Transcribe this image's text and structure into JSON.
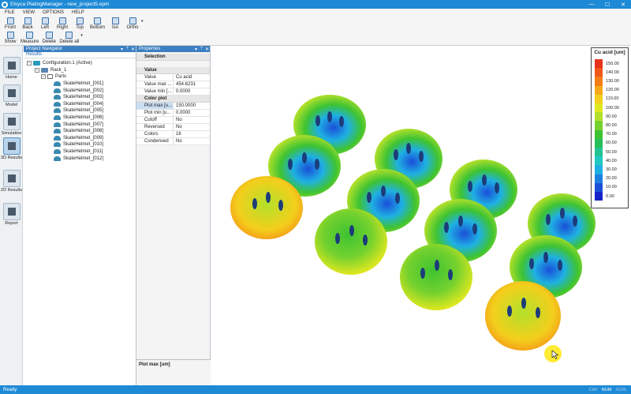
{
  "window": {
    "title": "Elsyca PlatingManager - new_project5.epm",
    "minimize": "—",
    "maximize": "☐",
    "close": "✕"
  },
  "menu": [
    "FILE",
    "VIEW",
    "OPTIONS",
    "HELP"
  ],
  "toolbar": {
    "views": [
      "Front",
      "Back",
      "Left",
      "Right",
      "Top",
      "Bottom",
      "Iso",
      "Ortho"
    ],
    "tools": [
      "Show",
      "Measure",
      "Delete",
      "Delete all"
    ]
  },
  "sidebar": {
    "items": [
      {
        "label": "Home",
        "icon": "house-icon"
      },
      {
        "label": "Model",
        "icon": "model-icon"
      },
      {
        "label": "Simulation",
        "icon": "calculator-icon"
      },
      {
        "label": "3D Results",
        "icon": "cube-icon"
      },
      {
        "label": "2D Results",
        "icon": "bar-chart-icon"
      },
      {
        "label": "Report",
        "icon": "document-icon"
      }
    ]
  },
  "navigator": {
    "title": "Project Navigator",
    "tab": "Results",
    "configuration": "Configuration.1 (Active)",
    "rack": "Rack_1",
    "parts_label": "Parts",
    "parts": [
      "SkateHelmet_[001]",
      "SkateHelmet_[002]",
      "SkateHelmet_[003]",
      "SkateHelmet_[004]",
      "SkateHelmet_[005]",
      "SkateHelmet_[006]",
      "SkateHelmet_[007]",
      "SkateHelmet_[008]",
      "SkateHelmet_[009]",
      "SkateHelmet_[010]",
      "SkateHelmet_[011]",
      "SkateHelmet_[012]"
    ]
  },
  "properties": {
    "title": "Properties",
    "sections": {
      "selection": "Selection",
      "value": "Value",
      "color_plot": "Color plot"
    },
    "value_rows": [
      {
        "key": "Value",
        "value": "Cu acid"
      },
      {
        "key": "Value max ...",
        "value": "454.6231"
      },
      {
        "key": "Value min [...",
        "value": "0.0000"
      }
    ],
    "color_rows": [
      {
        "key": "Plot max [u...",
        "value": "150.0000"
      },
      {
        "key": "Plot min [u...",
        "value": "0.0000"
      },
      {
        "key": "Cutoff",
        "value": "No"
      },
      {
        "key": "Reversed",
        "value": "No"
      },
      {
        "key": "Colors",
        "value": "16"
      },
      {
        "key": "Condensed",
        "value": "No"
      }
    ],
    "description": "Plot max [um]"
  },
  "legend": {
    "title": "Cu acid [um]",
    "entries": [
      {
        "label": "150.00",
        "color": "#e8321e"
      },
      {
        "label": "140.00",
        "color": "#f0561a"
      },
      {
        "label": "130.00",
        "color": "#f57d16"
      },
      {
        "label": "120.00",
        "color": "#f7a819"
      },
      {
        "label": "110.00",
        "color": "#f3cf1c"
      },
      {
        "label": "100.00",
        "color": "#e0e820"
      },
      {
        "label": "90.00",
        "color": "#b2e02a"
      },
      {
        "label": "80.00",
        "color": "#74d12e"
      },
      {
        "label": "70.00",
        "color": "#3ec332"
      },
      {
        "label": "60.00",
        "color": "#25bf5a"
      },
      {
        "label": "50.00",
        "color": "#22c391"
      },
      {
        "label": "40.00",
        "color": "#21c8c2"
      },
      {
        "label": "30.00",
        "color": "#1fb0e3"
      },
      {
        "label": "20.00",
        "color": "#1c80e0"
      },
      {
        "label": "10.00",
        "color": "#1a4fd8"
      },
      {
        "label": "0.00",
        "color": "#1723c9"
      }
    ]
  },
  "status": {
    "text": "Ready",
    "indicators": [
      "CAP",
      "NUM",
      "SCRL"
    ]
  }
}
